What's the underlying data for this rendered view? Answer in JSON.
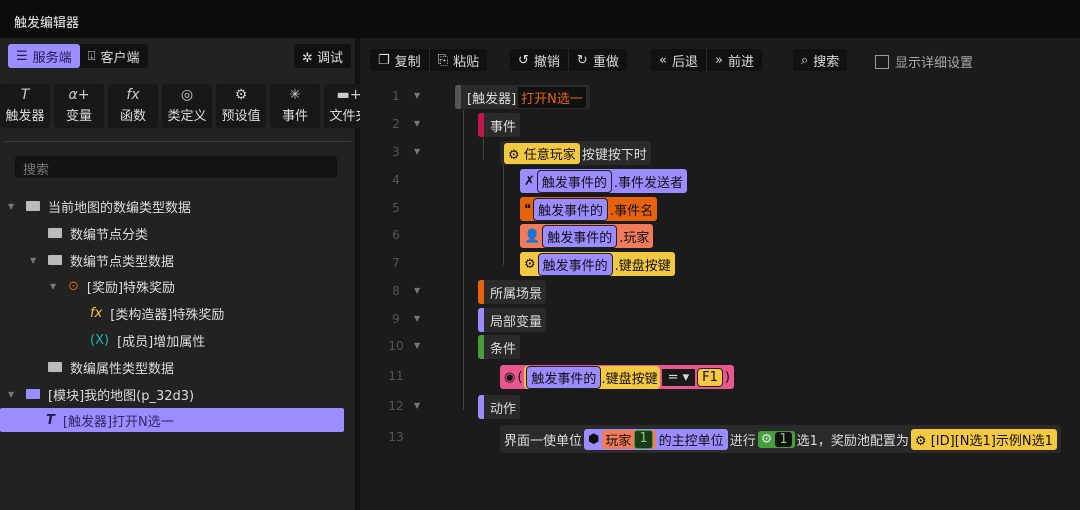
{
  "title": "触发编辑器",
  "left": {
    "tabs": [
      "服务端",
      "客户端"
    ],
    "debug": "调试",
    "tools": [
      {
        "icon": "T",
        "label": "触发器"
      },
      {
        "icon": "α+",
        "label": "变量"
      },
      {
        "icon": "fx",
        "label": "函数"
      },
      {
        "icon": "◎",
        "label": "类定义"
      },
      {
        "icon": "⚙",
        "label": "预设值"
      },
      {
        "icon": "✳",
        "label": "事件"
      },
      {
        "icon": "▬+",
        "label": "文件夹"
      }
    ],
    "search_placeholder": "搜索",
    "tree": [
      "当前地图的数编类型数据",
      "数编节点分类",
      "数编节点类型数据",
      "[奖励]特殊奖励",
      "[类构造器]特殊奖励",
      "[成员]增加属性",
      "数编属性类型数据",
      "[模块]我的地图(p_32d3)",
      "[触发器]打开N选一"
    ]
  },
  "toolbar": {
    "copy": "复制",
    "paste": "粘贴",
    "undo": "撤销",
    "redo": "重做",
    "back": "后退",
    "forward": "前进",
    "search": "搜索",
    "detail": "显示详细设置"
  },
  "editor": {
    "lines": [
      "1",
      "2",
      "3",
      "4",
      "5",
      "6",
      "7",
      "8",
      "9",
      "10",
      "11",
      "12",
      "13"
    ],
    "trigger_prefix": "[触发器]",
    "trigger_name": "打开N选一",
    "event": "事件",
    "any_player": "任意玩家",
    "key_down": "按键按下时",
    "trigger_event_of": "触发事件的",
    "sender": ".事件发送者",
    "event_name": ".事件名",
    "player": ".玩家",
    "key": ".键盘按键",
    "scene": "所属场景",
    "local_vars": "局部变量",
    "condition": "条件",
    "op": "=",
    "f1": "F1",
    "paren_open": "(",
    "paren_close": ")",
    "action": "动作",
    "a1": "界面一使单位",
    "a_player": "玩家",
    "a_num": "1",
    "a2": "的主控单位",
    "a3": "进行",
    "a_n": "1",
    "a4": "选1，奖励池配置为",
    "a_pool": "[ID][N选1]示例N选1"
  },
  "colors": {
    "accent": "#9b8cff",
    "event": "#c0164a",
    "yellow": "#f5c842",
    "orange": "#e8620c",
    "salmon": "#f07a5a",
    "green": "#46a03a",
    "pink": "#e8588e"
  }
}
